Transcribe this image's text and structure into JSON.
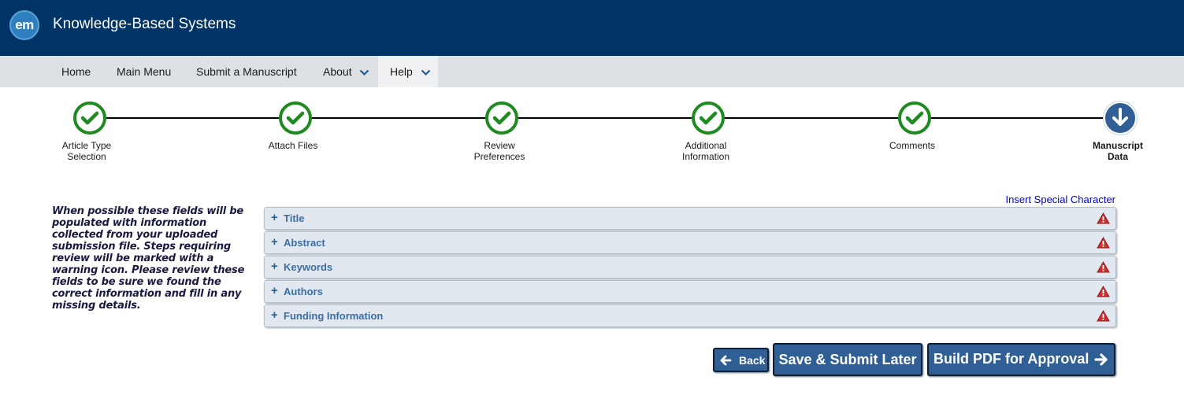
{
  "header": {
    "logo_text": "em",
    "app_title": "Knowledge-Based Systems"
  },
  "nav": {
    "items": [
      {
        "label": "Home"
      },
      {
        "label": "Main Menu"
      },
      {
        "label": "Submit a Manuscript"
      },
      {
        "label": "About",
        "dropdown": true
      },
      {
        "label": "Help",
        "dropdown": true,
        "active": true
      }
    ]
  },
  "steps": [
    {
      "line1": "Article Type",
      "line2": "Selection",
      "status": "complete",
      "icon": "check-icon"
    },
    {
      "line1": "Attach Files",
      "line2": "",
      "status": "complete",
      "icon": "check-icon"
    },
    {
      "line1": "Review",
      "line2": "Preferences",
      "status": "complete",
      "icon": "check-icon"
    },
    {
      "line1": "Additional",
      "line2": "Information",
      "status": "complete",
      "icon": "check-icon"
    },
    {
      "line1": "Comments",
      "line2": "",
      "status": "complete",
      "icon": "check-icon"
    },
    {
      "line1": "Manuscript",
      "line2": "Data",
      "status": "current",
      "icon": "arrow-down-icon"
    }
  ],
  "help_text": "When possible these fields will be populated with information collected from your uploaded submission file. Steps requiring review will be marked with a warning icon. Please review these fields to be sure we found the correct information and fill in any missing details.",
  "special_char_link": "Insert Special Character",
  "panels": [
    {
      "label": "Title",
      "icon": "warning-icon"
    },
    {
      "label": "Abstract",
      "icon": "warning-icon"
    },
    {
      "label": "Keywords",
      "icon": "warning-icon"
    },
    {
      "label": "Authors",
      "icon": "warning-icon"
    },
    {
      "label": "Funding Information",
      "icon": "warning-icon"
    }
  ],
  "buttons": {
    "back": "Back",
    "save_later": "Save & Submit Later",
    "build_pdf": "Build PDF for Approval"
  },
  "colors": {
    "header_bg": "#003366",
    "nav_bg": "#dde1e5",
    "step_complete": "#1f8a1f",
    "step_current": "#2f5f95",
    "button_bg": "#2f5f95",
    "warning": "#d32f2f"
  }
}
